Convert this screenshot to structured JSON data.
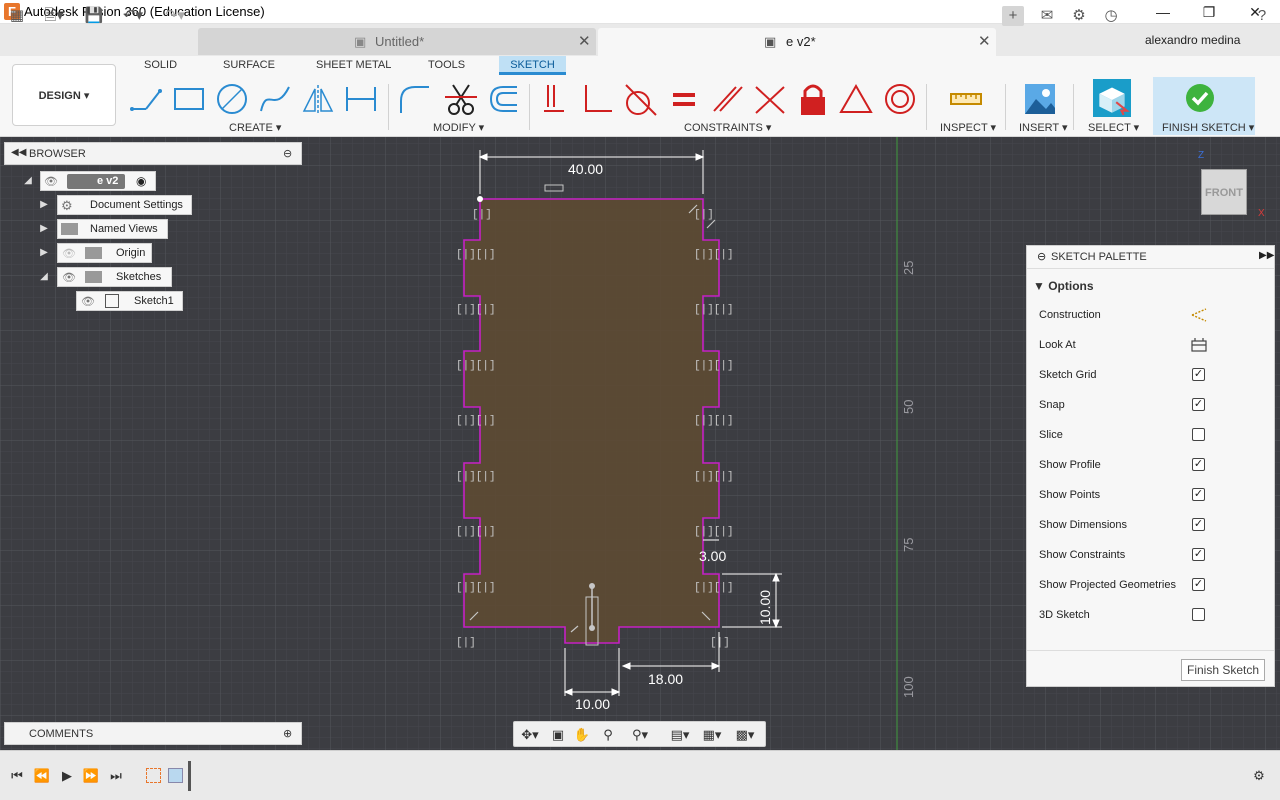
{
  "window": {
    "title": "Autodesk Fusion 360 (Education License)",
    "logo": "F"
  },
  "tabs": [
    {
      "label": "Untitled*"
    },
    {
      "label": "e v2*"
    }
  ],
  "user": {
    "name": "alexandro medina"
  },
  "workspace": {
    "label": "DESIGN"
  },
  "workspace_tabs": [
    "SOLID",
    "SURFACE",
    "SHEET METAL",
    "TOOLS",
    "SKETCH"
  ],
  "tool_groups": {
    "create": "CREATE",
    "modify": "MODIFY",
    "constraints": "CONSTRAINTS",
    "inspect": "INSPECT",
    "insert": "INSERT",
    "select": "SELECT",
    "finish": "FINISH SKETCH"
  },
  "browser": {
    "title": "BROWSER",
    "root": "e v2",
    "nodes": [
      "Document Settings",
      "Named Views",
      "Origin",
      "Sketches"
    ],
    "sketch": "Sketch1"
  },
  "comments": {
    "title": "COMMENTS"
  },
  "palette": {
    "title": "SKETCH PALETTE",
    "section": "Options",
    "options": [
      {
        "label": "Construction",
        "type": "icon",
        "icon": "construction-icon"
      },
      {
        "label": "Look At",
        "type": "icon",
        "icon": "look-at-icon"
      },
      {
        "label": "Sketch Grid",
        "type": "check",
        "checked": true
      },
      {
        "label": "Snap",
        "type": "check",
        "checked": true
      },
      {
        "label": "Slice",
        "type": "check",
        "checked": false
      },
      {
        "label": "Show Profile",
        "type": "check",
        "checked": true
      },
      {
        "label": "Show Points",
        "type": "check",
        "checked": true
      },
      {
        "label": "Show Dimensions",
        "type": "check",
        "checked": true
      },
      {
        "label": "Show Constraints",
        "type": "check",
        "checked": true
      },
      {
        "label": "Show Projected Geometries",
        "type": "check",
        "checked": true
      },
      {
        "label": "3D Sketch",
        "type": "check",
        "checked": false
      }
    ],
    "finish_button": "Finish Sketch"
  },
  "canvas": {
    "dimensions": [
      "40.00",
      "3.00",
      "10.00",
      "18.00",
      "10.00"
    ],
    "ruler": [
      "25",
      "50",
      "75",
      "100"
    ],
    "viewcube": "FRONT"
  },
  "colors": {
    "profile": "#c520c5",
    "accent": "#2a8bd1",
    "fill": "#5d4a33"
  }
}
